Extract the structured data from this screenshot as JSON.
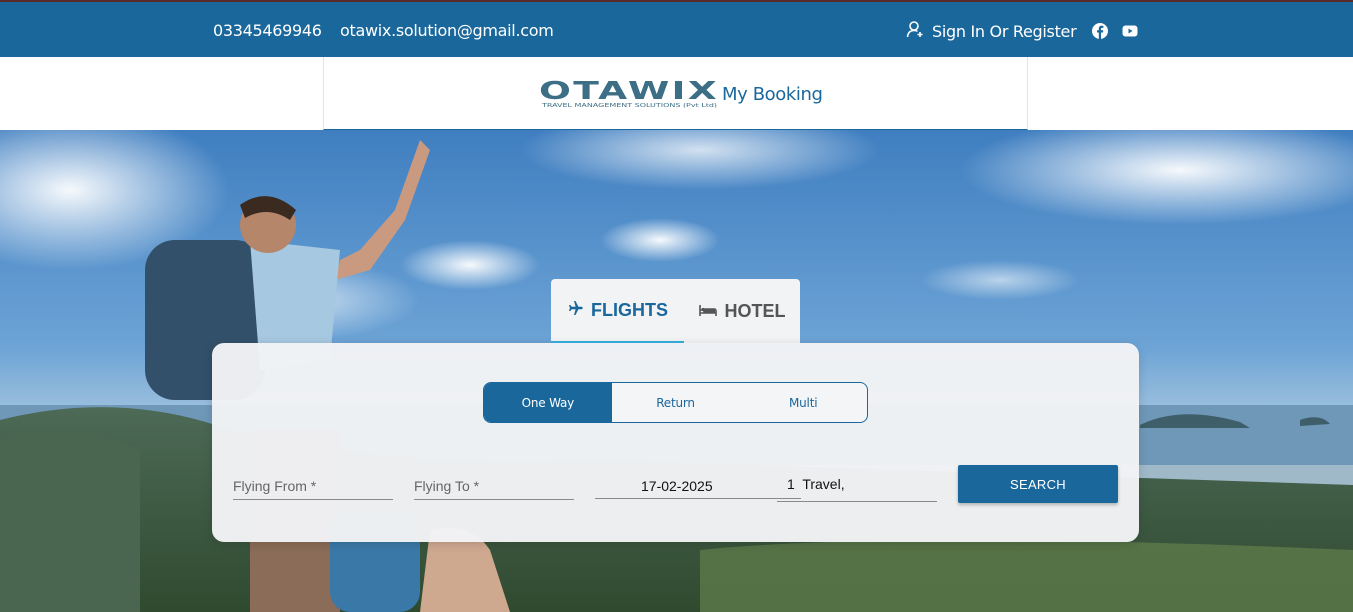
{
  "topbar": {
    "phone": "03345469946",
    "email": "otawix.solution@gmail.com",
    "signin_label": "Sign In Or Register",
    "social_icons": [
      "facebook-icon",
      "youtube-icon"
    ]
  },
  "header": {
    "logo_text": "OTAWIX",
    "logo_tagline": "TRAVEL MANAGEMENT SOLUTIONS (Pvt Ltd)",
    "my_booking": "My Booking"
  },
  "tabs": {
    "flights": "FLIGHTS",
    "hotel": "HOTEL",
    "active": "flights"
  },
  "trip_types": {
    "one_way": "One Way",
    "return": "Return",
    "multi": "Multi",
    "selected": "One Way"
  },
  "search": {
    "from_label": "Flying From *",
    "to_label": "Flying To *",
    "date_value": "17-02-2025",
    "travellers_value": "1  Travel,",
    "button_label": "SEARCH"
  },
  "colors": {
    "primary": "#1a679c",
    "tab_accent": "#36b0e0",
    "card_bg": "#f2f3f5"
  }
}
